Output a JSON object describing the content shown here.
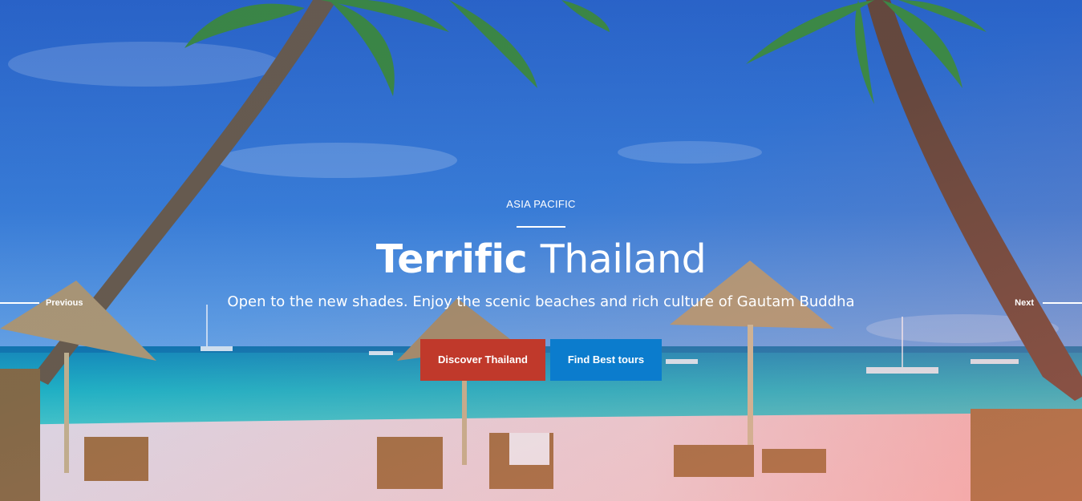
{
  "hero": {
    "eyebrow": "ASIA PACIFIC",
    "title_strong": "Terrific",
    "title_light": "Thailand",
    "subtitle": "Open to the new shades. Enjoy the scenic beaches and rich culture of Gautam Buddha"
  },
  "buttons": {
    "primary_label": "Discover Thailand",
    "secondary_label": "Find Best tours"
  },
  "navigation": {
    "previous_label": "Previous",
    "next_label": "Next"
  },
  "colors": {
    "primary_button": "#c0392b",
    "secondary_button": "#0b7ccd",
    "text": "#ffffff"
  }
}
